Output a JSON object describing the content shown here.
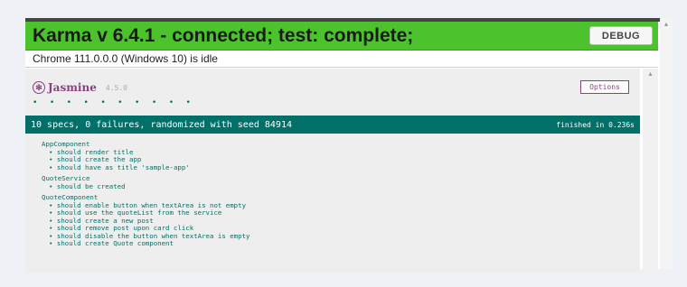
{
  "karma": {
    "banner_title": "Karma v 6.4.1 - connected; test: complete;",
    "debug_label": "DEBUG",
    "browser_status": "Chrome 111.0.0.0 (Windows 10) is idle",
    "banner_color": "#4cc32d"
  },
  "jasmine": {
    "name": "Jasmine",
    "version": "4.5.0",
    "dots": "• • • • • • • • • •",
    "options_label": "Options",
    "summary": "10 specs, 0 failures, randomized with seed 84914",
    "duration": "finished in 0.236s",
    "accent_color": "#007069",
    "brand_color": "#8a4182"
  },
  "suites": [
    {
      "name": "AppComponent",
      "specs": [
        "should render title",
        "should create the app",
        "should have as title 'sample-app'"
      ]
    },
    {
      "name": "QuoteService",
      "specs": [
        "should be created"
      ]
    },
    {
      "name": "QuoteComponent",
      "specs": [
        "should enable button when textArea is not empty",
        "should use the quoteList from the service",
        "should create a new post",
        "should remove post upon card click",
        "should disable the button when textArea is empty",
        "should create Quote component"
      ]
    }
  ],
  "icons": {
    "jasmine_logo": "jasmine-logo-icon",
    "scroll_up": "chevron-up-icon"
  }
}
